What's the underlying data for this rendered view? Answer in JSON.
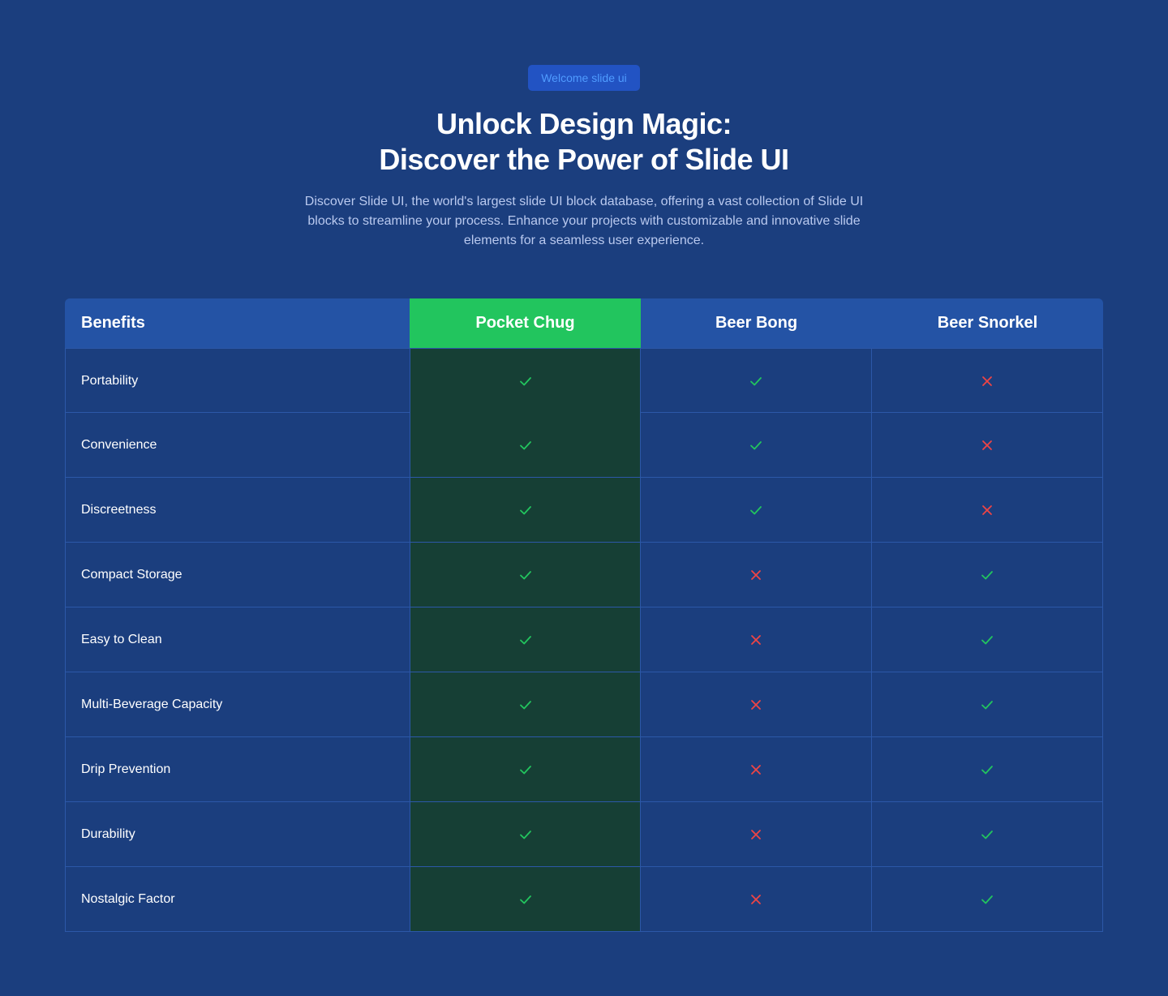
{
  "hero": {
    "badge": "Welcome slide ui",
    "title_line1": "Unlock Design Magic:",
    "title_line2": "Discover the Power of Slide UI",
    "description": "Discover Slide UI, the world's largest slide UI block database, offering a vast collection of Slide UI blocks to streamline your process. Enhance your projects with customizable and innovative slide elements for a seamless user experience."
  },
  "table": {
    "header_benefits": "Benefits",
    "columns": [
      "Pocket Chug",
      "Beer Bong",
      "Beer Snorkel"
    ],
    "highlight_column": 0,
    "rows": [
      {
        "benefit": "Portability",
        "values": [
          true,
          true,
          false
        ]
      },
      {
        "benefit": "Convenience",
        "values": [
          true,
          true,
          false
        ]
      },
      {
        "benefit": "Discreetness",
        "values": [
          true,
          true,
          false
        ]
      },
      {
        "benefit": "Compact Storage",
        "values": [
          true,
          false,
          true
        ]
      },
      {
        "benefit": "Easy to Clean",
        "values": [
          true,
          false,
          true
        ]
      },
      {
        "benefit": "Multi-Beverage Capacity",
        "values": [
          true,
          false,
          true
        ]
      },
      {
        "benefit": "Drip Prevention",
        "values": [
          true,
          false,
          true
        ]
      },
      {
        "benefit": "Durability",
        "values": [
          true,
          false,
          true
        ]
      },
      {
        "benefit": "Nostalgic Factor",
        "values": [
          true,
          false,
          true
        ]
      }
    ]
  },
  "icons": {
    "yes": "check-icon",
    "no": "cross-icon"
  },
  "colors": {
    "background": "#1b3e7e",
    "header": "#2453a5",
    "highlight": "#22c55e",
    "highlight_cell": "#163f35",
    "check": "#22c55e",
    "cross": "#ef4444",
    "badge_bg": "#2253c3",
    "badge_text": "#4f9bff"
  }
}
